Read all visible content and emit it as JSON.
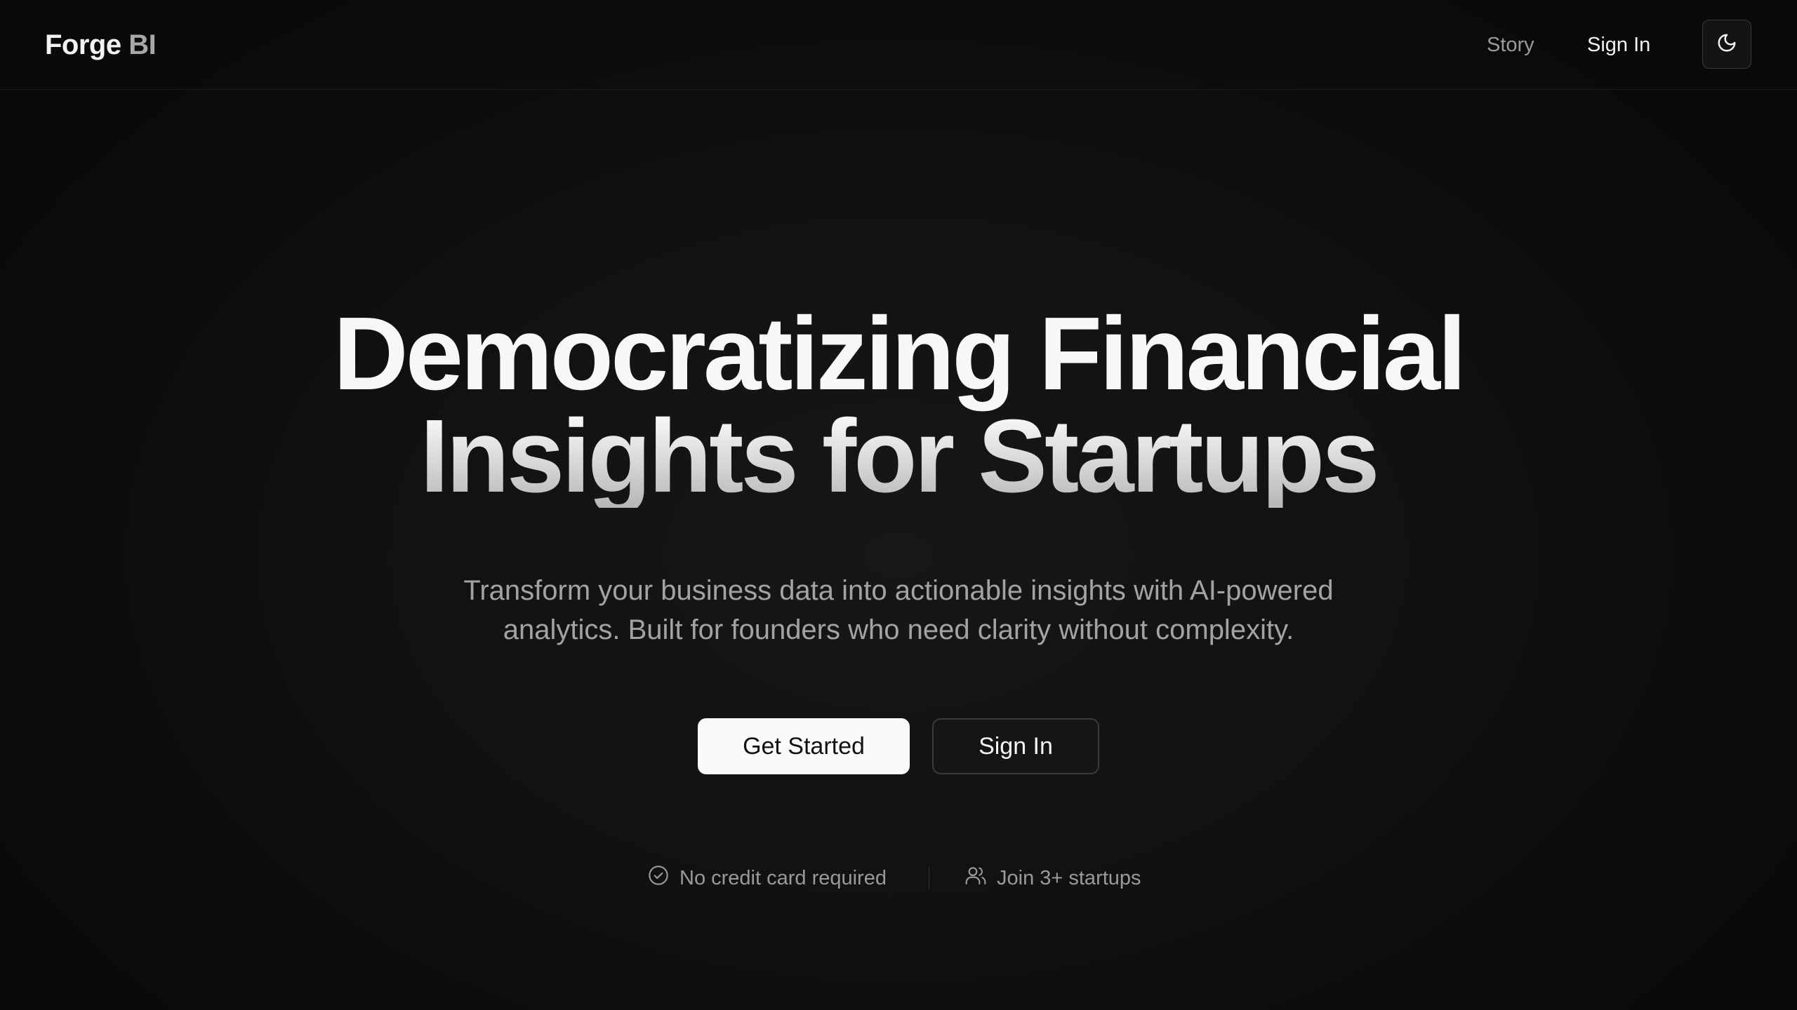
{
  "brand": {
    "name_primary": "Forge",
    "name_secondary": "BI"
  },
  "nav": {
    "story_label": "Story",
    "signin_label": "Sign In",
    "theme_toggle_icon": "moon-icon"
  },
  "hero": {
    "title_line1": "Democratizing Financial",
    "title_line2": "Insights for Startups",
    "subtitle": "Transform your business data into actionable insights with AI-powered analytics. Built for founders who need clarity without complexity.",
    "primary_cta": "Get Started",
    "secondary_cta": "Sign In"
  },
  "trust": {
    "item1_icon": "check-circle-icon",
    "item1_label": "No credit card required",
    "item2_icon": "users-icon",
    "item2_label": "Join 3+ startups"
  },
  "colors": {
    "background": "#0b0b0b",
    "text_primary": "#f5f5f5",
    "text_muted": "#9a9a9a",
    "button_primary_bg": "#fafafa",
    "button_secondary_bg": "#151515"
  }
}
